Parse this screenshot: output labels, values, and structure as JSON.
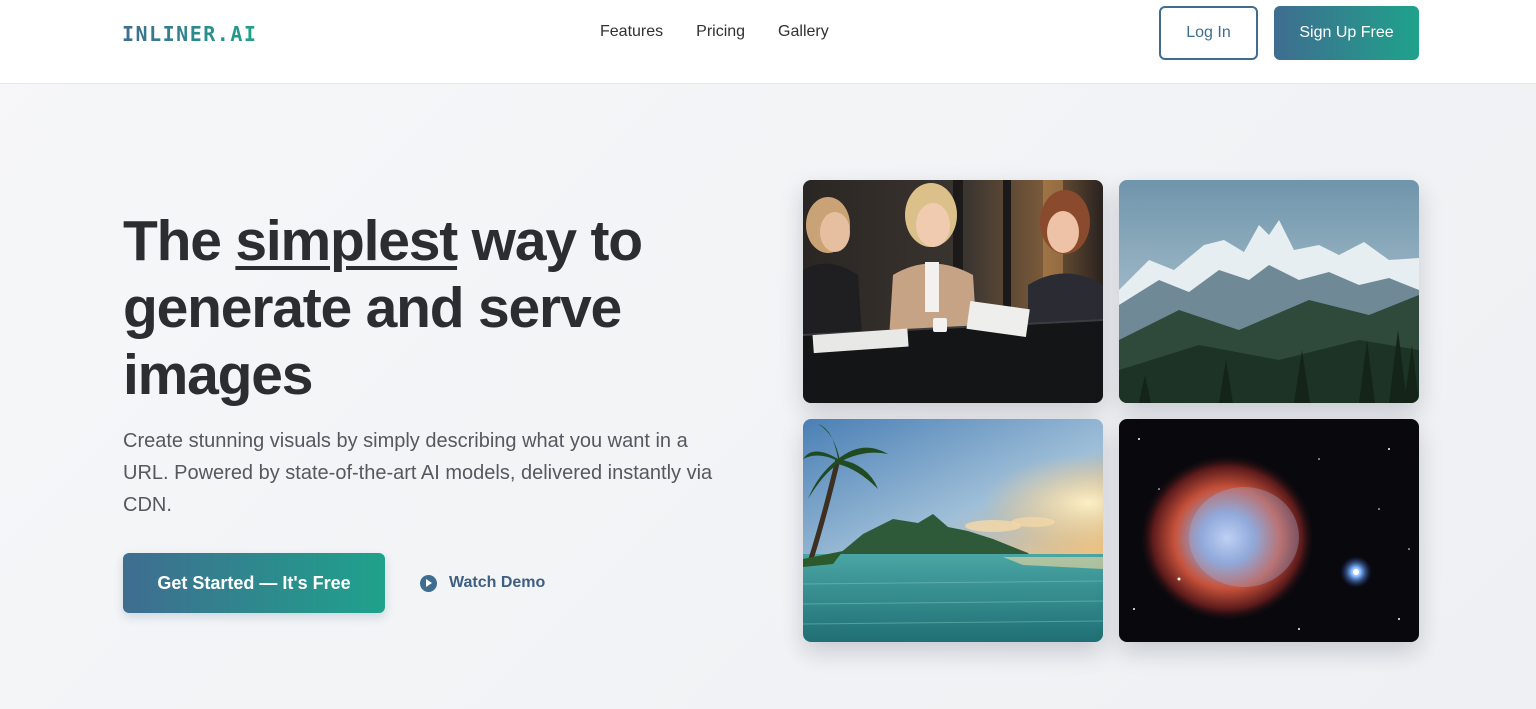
{
  "nav": {
    "logo": "INLINER.AI",
    "links": [
      "Features",
      "Pricing",
      "Gallery"
    ],
    "login_label": "Log In",
    "signup_label": "Sign Up Free"
  },
  "hero": {
    "title_before": "The ",
    "title_emphasis": "simplest",
    "title_after": " way to generate and serve images",
    "subtitle": "Create stunning visuals by simply describing what you want in a URL. Powered by state-of-the-art AI models, delivered instantly via CDN.",
    "cta_label": "Get Started — It's Free",
    "demo_label": "Watch Demo"
  },
  "gallery": {
    "images": [
      {
        "subject": "three businesswomen meeting at a table"
      },
      {
        "subject": "snowy mountain peaks above a pine forest"
      },
      {
        "subject": "tropical beach with palm tree at sunset"
      },
      {
        "subject": "colorful nebula in deep space"
      }
    ]
  },
  "colors": {
    "brand_blue": "#3f6d90",
    "brand_teal": "#1fa28b",
    "text_dark": "#2c2d30",
    "text_muted": "#55585e"
  }
}
